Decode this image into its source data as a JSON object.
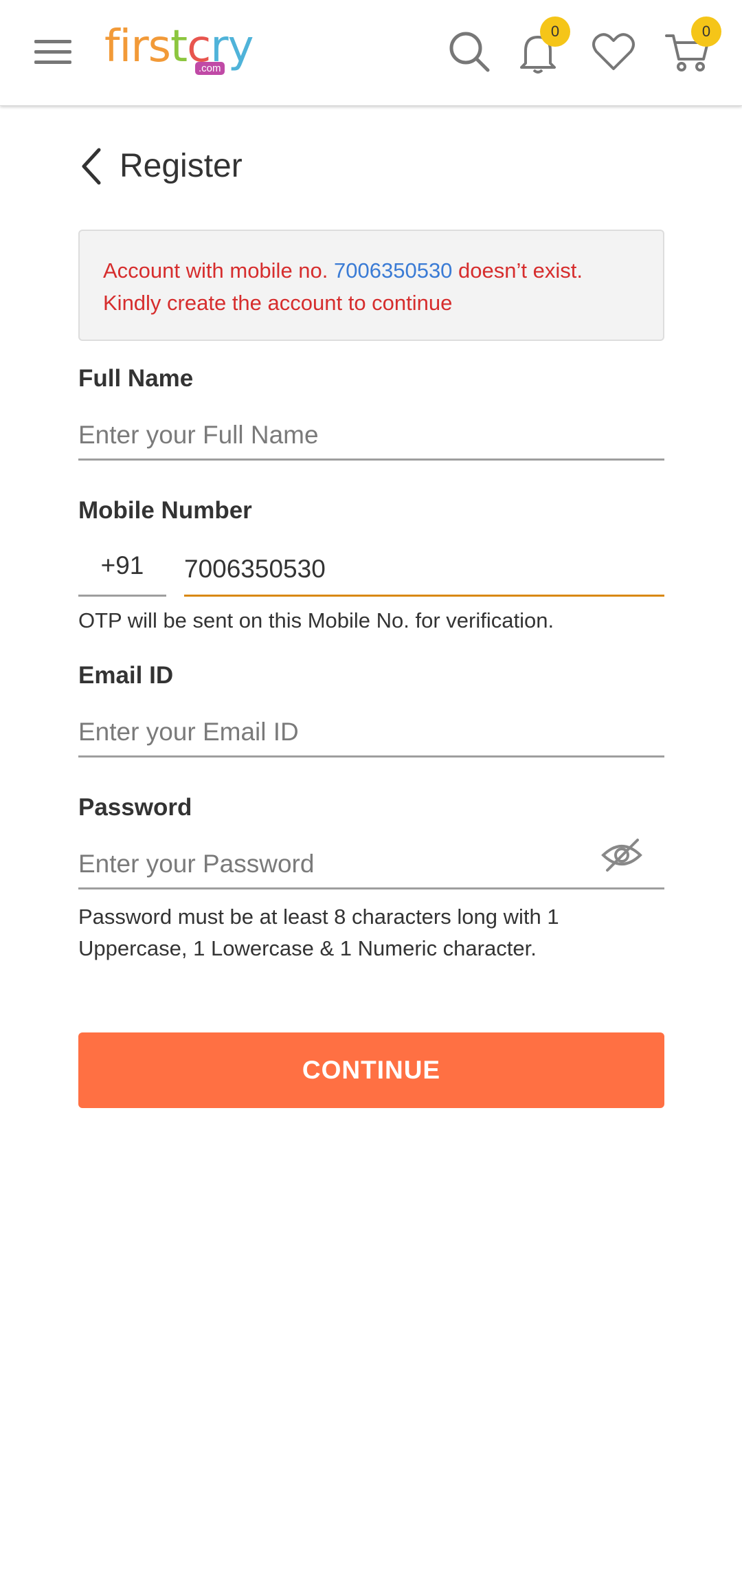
{
  "header": {
    "logo": {
      "letters": [
        "f",
        "i",
        "r",
        "s",
        "t",
        "c",
        "r",
        "y"
      ],
      "colors": [
        "#f29a38",
        "#f29a38",
        "#f29a38",
        "#f29a38",
        "#8cc63f",
        "#e8554e",
        "#4fb3d9",
        "#4fb3d9"
      ],
      "suffix": ".com"
    },
    "icons": [
      "menu-icon",
      "search-icon",
      "bell-icon",
      "heart-icon",
      "cart-icon"
    ],
    "notification_count": "0",
    "cart_count": "0"
  },
  "page": {
    "title": "Register"
  },
  "alert": {
    "prefix": "Account with mobile no. ",
    "number": "7006350530",
    "suffix": " doesn’t exist.",
    "line2": "Kindly create the account to continue"
  },
  "form": {
    "full_name": {
      "label": "Full Name",
      "placeholder": "Enter your Full Name",
      "value": ""
    },
    "mobile": {
      "label": "Mobile Number",
      "country_code": "+91",
      "value": "7006350530",
      "hint": "OTP will be sent on this Mobile No. for verification."
    },
    "email": {
      "label": "Email ID",
      "placeholder": "Enter your Email ID",
      "value": ""
    },
    "password": {
      "label": "Password",
      "placeholder": "Enter your Password",
      "value": "",
      "hint_line1": "Password must be at least 8 characters long with 1",
      "hint_line2": "Uppercase, 1 Lowercase & 1 Numeric character."
    }
  },
  "actions": {
    "continue_label": "CONTINUE"
  },
  "colors": {
    "accent": "#ff7043",
    "error": "#d62d2d",
    "link": "#3a7bd5",
    "active_underline": "#d9880f",
    "badge": "#f5c518"
  }
}
